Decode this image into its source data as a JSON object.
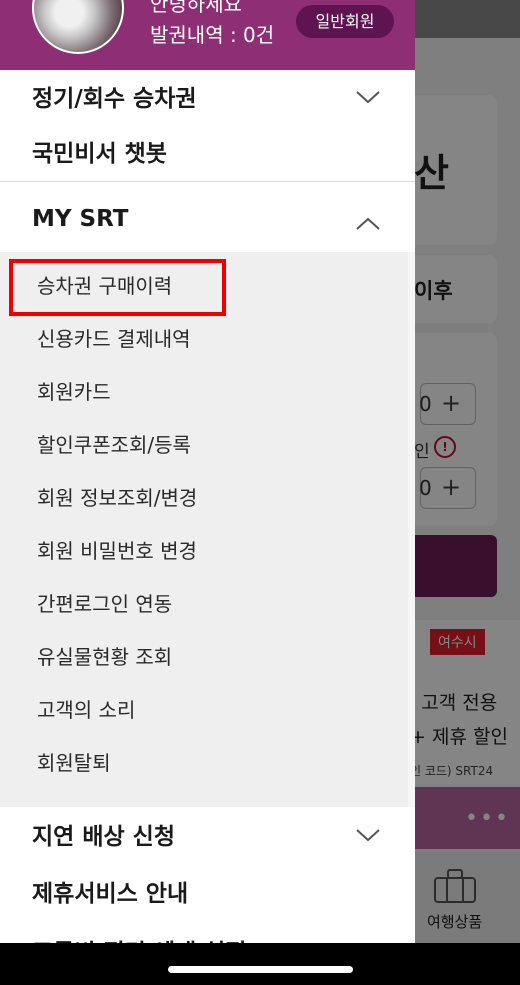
{
  "background": {
    "title_fragment": "산",
    "time_fragment": "이후",
    "stepper1_value": "0",
    "stepper2_value": "0",
    "stepper_plus": "+",
    "info_label": "인",
    "info_icon": "!",
    "ad_badge": "여수시",
    "ad_line1": "' 고객 전용",
    "ad_line2": "+ 제휴 할인",
    "ad_line3": "인 코드) SRT24",
    "more_icon": "•••",
    "nav_travel_label": "여행상품"
  },
  "drawer": {
    "header": {
      "greeting": "안녕하세요",
      "ticket_count": "발권내역 : 0건",
      "member_badge": "일반회원"
    },
    "menu": {
      "pass": "정기/회수 승차권",
      "chatbot": "국민비서 챗봇",
      "mysrt": "MY SRT",
      "delay": "지연 배상 신청",
      "partner": "제휴서비스 안내",
      "cut_off": "교통비 정리 예매 설정"
    },
    "mysrt_items": [
      "승차권 구매이력",
      "신용카드 결제내역",
      "회원카드",
      "할인쿠폰조회/등록",
      "회원 정보조회/변경",
      "회원 비밀번호 변경",
      "간편로그인 연동",
      "유실물현황 조회",
      "고객의 소리",
      "회원탈퇴"
    ]
  },
  "colors": {
    "brand_purple": "#8e2f76",
    "badge_purple": "#5e1450",
    "highlight_red": "#ee0000"
  }
}
